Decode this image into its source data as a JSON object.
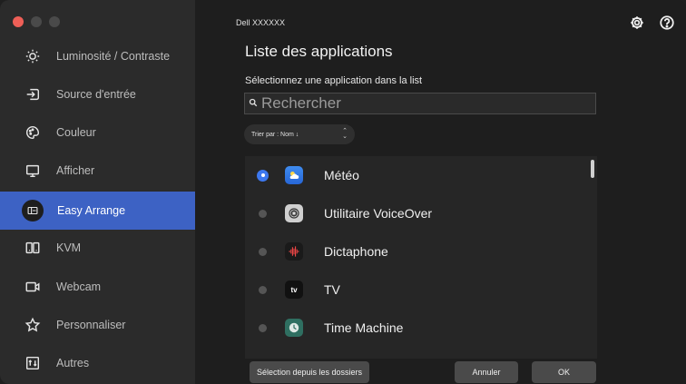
{
  "sidebar": {
    "items": [
      {
        "label": "Luminosité / Contraste",
        "icon": "brightness-icon"
      },
      {
        "label": "Source d'entrée",
        "icon": "input-source-icon"
      },
      {
        "label": "Couleur",
        "icon": "color-palette-icon"
      },
      {
        "label": "Afficher",
        "icon": "display-icon"
      },
      {
        "label": "Easy Arrange",
        "icon": "easy-arrange-icon",
        "active": true
      },
      {
        "label": "KVM",
        "icon": "kvm-icon"
      },
      {
        "label": "Webcam",
        "icon": "webcam-icon"
      },
      {
        "label": "Personnaliser",
        "icon": "star-icon"
      },
      {
        "label": "Autres",
        "icon": "others-icon"
      }
    ]
  },
  "header": {
    "model": "Dell XXXXXX",
    "settings_icon": "gear-icon",
    "help_icon": "help-icon"
  },
  "main": {
    "title": "Liste des applications",
    "subtitle": "Sélectionnez une application dans la list",
    "search": {
      "placeholder": "Rechercher",
      "value": ""
    },
    "sort_label": "Trier par : Nom ↓",
    "apps": [
      {
        "name": "Météo",
        "selected": true,
        "icon": "weather-app-icon"
      },
      {
        "name": "Utilitaire VoiceOver",
        "selected": false,
        "icon": "voiceover-app-icon"
      },
      {
        "name": "Dictaphone",
        "selected": false,
        "icon": "voice-memos-app-icon"
      },
      {
        "name": "TV",
        "selected": false,
        "icon": "apple-tv-app-icon"
      },
      {
        "name": "Time Machine",
        "selected": false,
        "icon": "time-machine-app-icon"
      }
    ],
    "tv_logo_text": "tv"
  },
  "footer": {
    "folders_button": "Sélection depuis les dossiers",
    "cancel_button": "Annuler",
    "ok_button": "OK"
  },
  "colors": {
    "accent": "#3d62c4",
    "radio_selected": "#3d78ef",
    "close_dot": "#ee5f57"
  }
}
